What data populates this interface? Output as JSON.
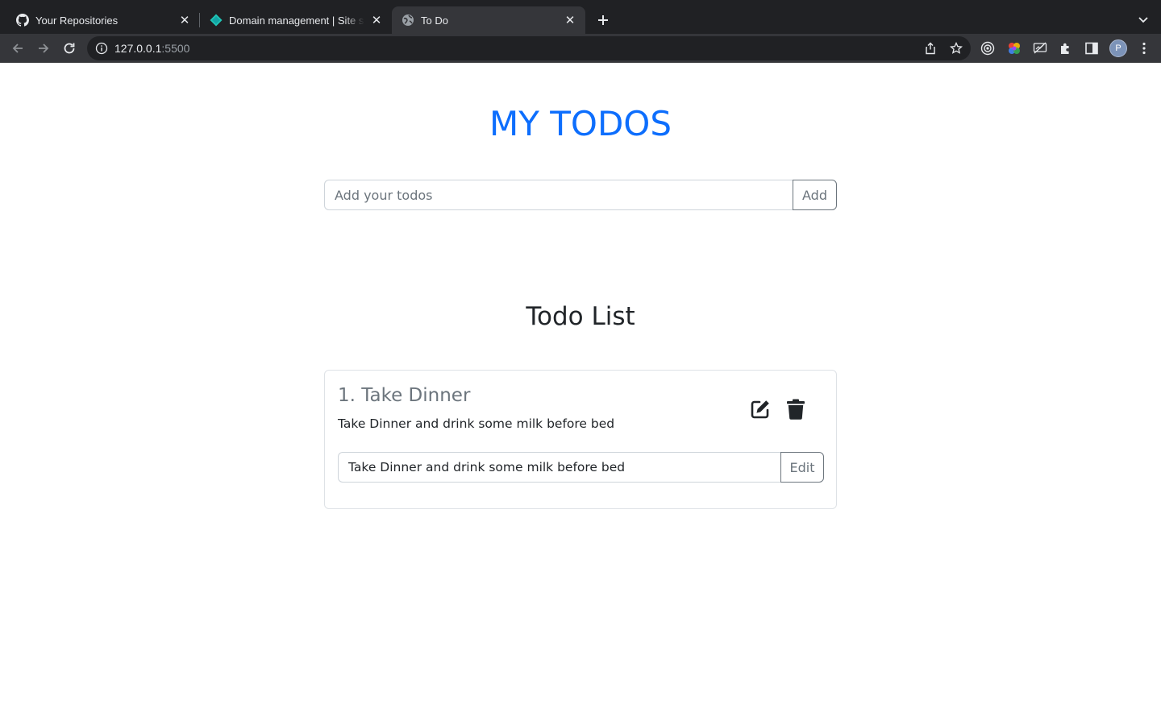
{
  "browser": {
    "tabs": [
      {
        "title": "Your Repositories",
        "icon": "github-icon",
        "active": false
      },
      {
        "title": "Domain management | Site settings",
        "icon": "netlify-icon",
        "active": false
      },
      {
        "title": "To Do",
        "icon": "globe-icon",
        "active": true
      }
    ],
    "address": {
      "host": "127.0.0.1",
      "port": ":5500"
    },
    "profile_initial": "P"
  },
  "app": {
    "title": "MY TODOS",
    "add_placeholder": "Add your todos",
    "add_value": "",
    "add_button": "Add",
    "list_heading": "Todo List",
    "todos": [
      {
        "title": "1. Take Dinner",
        "description": "Take Dinner and drink some milk before bed",
        "edit_value": "Take Dinner and drink some milk before bed",
        "edit_button": "Edit"
      }
    ]
  },
  "colors": {
    "accent": "#0d6efd",
    "chrome_dark": "#202124",
    "chrome_toolbar": "#35363a"
  }
}
